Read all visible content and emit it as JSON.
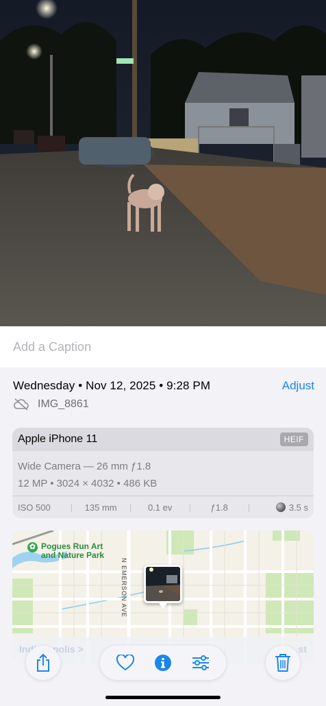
{
  "caption": {
    "placeholder": "Add a Caption"
  },
  "info": {
    "datetime": "Wednesday • Nov 12, 2025 • 9:28 PM",
    "adjust_label": "Adjust",
    "filename": "IMG_8861",
    "cloud_status_icon": "cloud-slash-icon"
  },
  "camera": {
    "model": "Apple iPhone 11",
    "format_badge": "HEIF",
    "lens": "Wide Camera — 26 mm ƒ1.8",
    "specs": "12 MP • 3024 × 4032 • 486 KB",
    "stats": {
      "iso": "ISO 500",
      "focal": "135 mm",
      "ev": "0.1 ev",
      "aperture": "ƒ1.8",
      "shutter": "3.5 s"
    }
  },
  "map": {
    "park_label_line1": "Pogues Run Art",
    "park_label_line2": "and Nature Park",
    "street_label": "N EMERSON AVE",
    "city_label": "Indianapolis >",
    "directions_label": "st"
  },
  "toolbar": {
    "share_icon": "share-icon",
    "favorite_icon": "heart-icon",
    "info_icon": "info-icon",
    "edit_icon": "sliders-icon",
    "delete_icon": "trash-icon"
  },
  "colors": {
    "accent": "#1a86ec",
    "background": "#f2f2f7",
    "card": "#e7e7ec"
  }
}
